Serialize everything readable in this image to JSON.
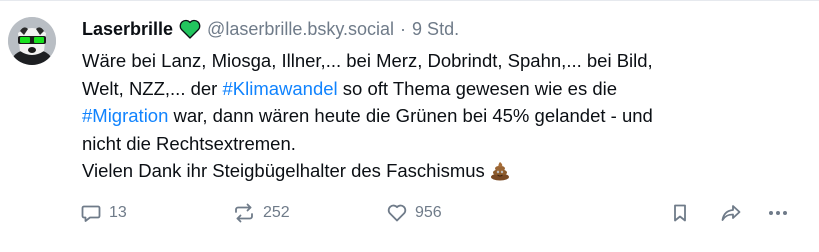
{
  "author": {
    "display_name": "Laserbrille",
    "badge_icon": "green-heart-icon",
    "handle": "@laserbrille.bsky.social",
    "separator": "·",
    "time": "9 Std."
  },
  "post": {
    "line1": "Wäre bei Lanz, Miosga, Illner,... bei Merz, Dobrindt, Spahn,... bei Bild,",
    "line2_pre": "Welt, NZZ,... der ",
    "hashtag1": "#Klimawandel",
    "line2_post": " so oft Thema gewesen wie es die",
    "hashtag2": "#Migration",
    "line3_post": " war, dann wären heute die Grünen bei 45% gelandet - und",
    "line4": "nicht die Rechtsextremen.",
    "line5": "Vielen Dank ihr Steigbügelhalter des Faschismus",
    "emoji_icon": "pile-of-poo-icon"
  },
  "actions": {
    "reply_count": "13",
    "repost_count": "252",
    "like_count": "956"
  },
  "colors": {
    "link": "#1083fe",
    "muted": "#6f7b89",
    "text": "#0b0f14",
    "heart": "#22c55e"
  }
}
